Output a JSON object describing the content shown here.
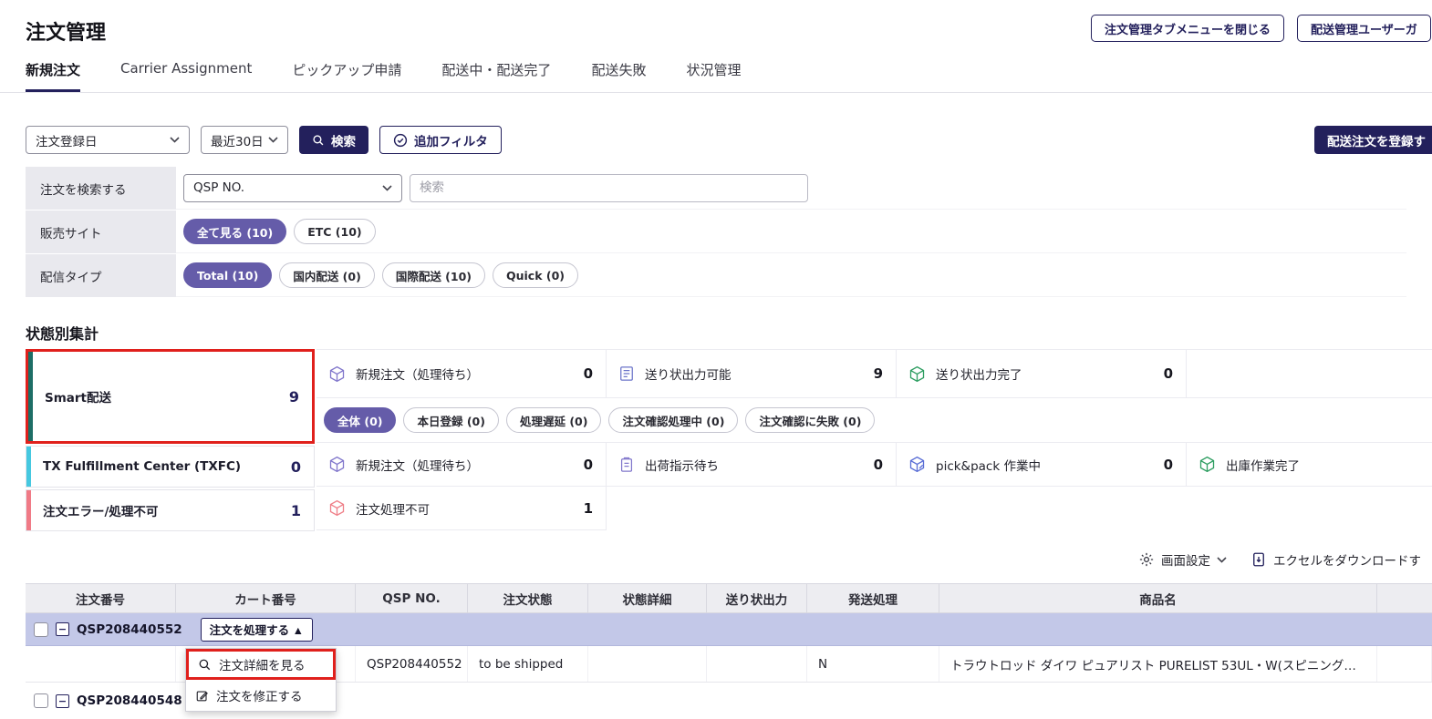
{
  "page": {
    "title": "注文管理"
  },
  "header": {
    "close_tab_menu_button": "注文管理タブメニューを閉じる",
    "user_guide_button": "配送管理ユーザーガ"
  },
  "tabs": [
    {
      "label": "新規注文"
    },
    {
      "label": "Carrier Assignment"
    },
    {
      "label": "ピックアップ申請"
    },
    {
      "label": "配送中・配送完了"
    },
    {
      "label": "配送失敗"
    },
    {
      "label": "状況管理"
    }
  ],
  "filter_bar": {
    "date_type_select": "注文登録日",
    "date_range_select": "最近30日",
    "search_button": "検索",
    "additional_filter_button": "追加フィルタ",
    "register_order_button": "配送注文を登録す"
  },
  "search_panel": {
    "rows": [
      {
        "label": "注文を検索する",
        "select_value": "QSP NO.",
        "input_placeholder": "検索"
      },
      {
        "label": "販売サイト",
        "pills": [
          {
            "label": "全て見る (10)"
          },
          {
            "label": "ETC (10)"
          }
        ]
      },
      {
        "label": "配信タイプ",
        "pills": [
          {
            "label": "Total (10)"
          },
          {
            "label": "国内配送 (0)"
          },
          {
            "label": "国際配送 (10)"
          },
          {
            "label": "Quick (0)"
          }
        ]
      }
    ]
  },
  "status_summary": {
    "heading": "状態別集計",
    "groups": [
      {
        "name": "Smart配送",
        "count": "9"
      },
      {
        "name": "TX Fulfillment Center (TXFC)",
        "count": "0"
      },
      {
        "name": "注文エラー/処理不可",
        "count": "1"
      }
    ],
    "smart_row": [
      {
        "label": "新規注文（処理待ち）",
        "value": "0"
      },
      {
        "label": "送り状出力可能",
        "value": "9"
      },
      {
        "label": "送り状出力完了",
        "value": "0"
      }
    ],
    "smart_pills": [
      {
        "label": "全体 (0)"
      },
      {
        "label": "本日登録 (0)"
      },
      {
        "label": "処理遅延 (0)"
      },
      {
        "label": "注文確認処理中 (0)"
      },
      {
        "label": "注文確認に失敗 (0)"
      }
    ],
    "txfc_row": [
      {
        "label": "新規注文（処理待ち）",
        "value": "0"
      },
      {
        "label": "出荷指示待ち",
        "value": "0"
      },
      {
        "label": "pick&pack 作業中",
        "value": "0"
      },
      {
        "label": "出庫作業完了",
        "value": ""
      }
    ],
    "error_row": [
      {
        "label": "注文処理不可",
        "value": "1"
      }
    ]
  },
  "table_toolbar": {
    "screen_settings": "画面設定",
    "excel_download": "エクセルをダウンロードす"
  },
  "orders_table": {
    "headers": [
      "注文番号",
      "カート番号",
      "QSP NO.",
      "注文状態",
      "状態詳細",
      "送り状出力",
      "発送処理",
      "商品名"
    ],
    "group_row": {
      "order_no": "QSP208440552",
      "process_button": "注文を処理する ▲",
      "minus": "−"
    },
    "context_menu": [
      {
        "label": "注文詳細を見る"
      },
      {
        "label": "注文を修正する"
      }
    ],
    "detail_row": {
      "qsp_no": "QSP208440552",
      "order_status": "to be shipped",
      "ship_process": "N",
      "product_name": "トラウトロッド ダイワ ピュアリスト PURELIST 53UL・W(スピニング・…"
    },
    "next_row": {
      "order_no": "QSP208440548",
      "minus": "−"
    }
  },
  "colors": {
    "primary_navy": "#23205C",
    "selected_pill_purple": "#655CA9",
    "annotation_red": "#E0201C",
    "group_row_bg": "#C3C8E8",
    "smart_bar_teal": "#1D6E66",
    "txfc_bar_cyan": "#45C8E0",
    "error_bar_pink": "#F07A86"
  },
  "icons": {
    "search_icon": "magnifier",
    "check_circle_icon": "circle-check",
    "chevron_down_icon": "chevron-down",
    "package_icon": "cube-outline",
    "invoice_icon": "document-lines",
    "package_done_icon": "cube-outline-green",
    "clipboard_icon": "clipboard",
    "package_error_icon": "cube-outline-red",
    "gear_icon": "gear",
    "excel_icon": "file-with-download-arrow",
    "collapse_icon": "minus-square",
    "edit_icon": "pencil",
    "collapse_arrow": "▲"
  }
}
